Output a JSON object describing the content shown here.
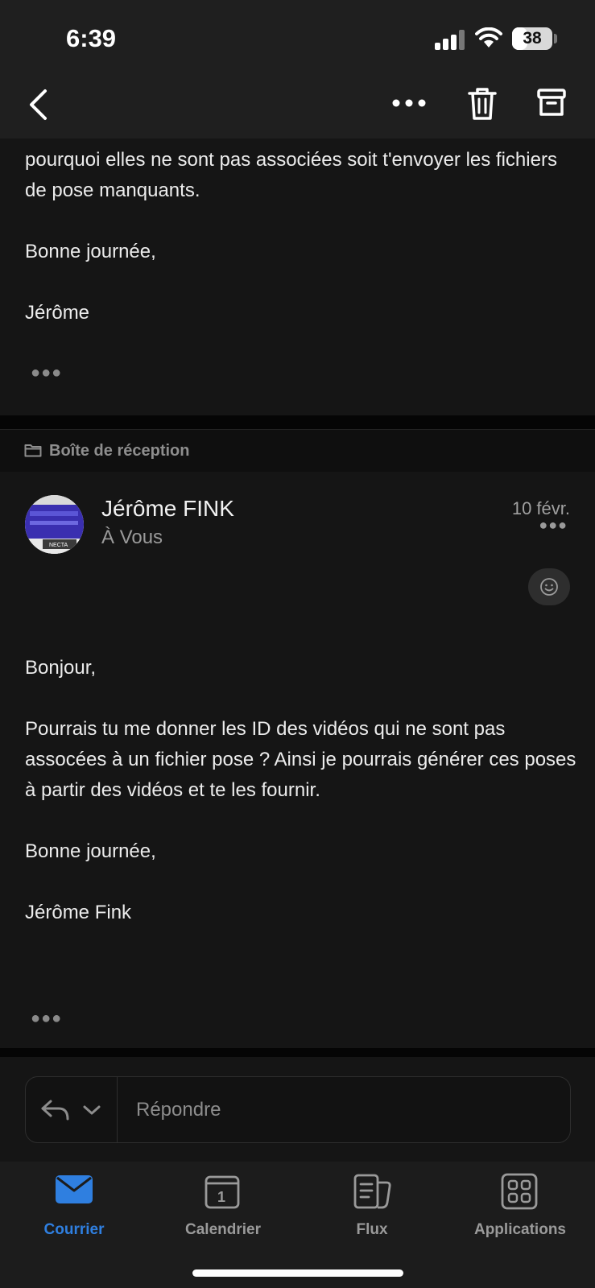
{
  "status": {
    "time": "6:39",
    "battery": "38",
    "battery_level": 0.38
  },
  "toolbar": {
    "back_icon": "chevron-left-icon",
    "more_icon": "more-horizontal-icon",
    "delete_icon": "trash-icon",
    "archive_icon": "archive-icon"
  },
  "previous_email": {
    "lines": [
      "pourquoi elles ne sont pas associées soit t'envoyer les fichiers de pose manquants.",
      "Bonne journée,",
      "Jérôme"
    ]
  },
  "folder": {
    "label": "Boîte de réception",
    "icon": "folder-icon"
  },
  "email": {
    "sender": "Jérôme FINK",
    "recipient": "À Vous",
    "date": "10 févr.",
    "avatar_caption": "NECTA",
    "body": [
      "Bonjour,",
      "Pourrais tu me donner les ID des vidéos qui ne sont pas assocées à un fichier pose ? Ainsi je pourrais générer ces poses à partir des vidéos et te les fournir.",
      "Bonne journée,",
      "Jérôme Fink"
    ]
  },
  "reply": {
    "placeholder": "Répondre"
  },
  "tabs": [
    {
      "label": "Courrier",
      "icon": "mail-icon",
      "active": true
    },
    {
      "label": "Calendrier",
      "icon": "calendar-icon",
      "badge": "1",
      "active": false
    },
    {
      "label": "Flux",
      "icon": "feed-icon",
      "active": false
    },
    {
      "label": "Applications",
      "icon": "apps-grid-icon",
      "active": false
    }
  ],
  "colors": {
    "accent": "#2f7fe0",
    "background": "#151515",
    "bar": "#1f1f1f"
  }
}
